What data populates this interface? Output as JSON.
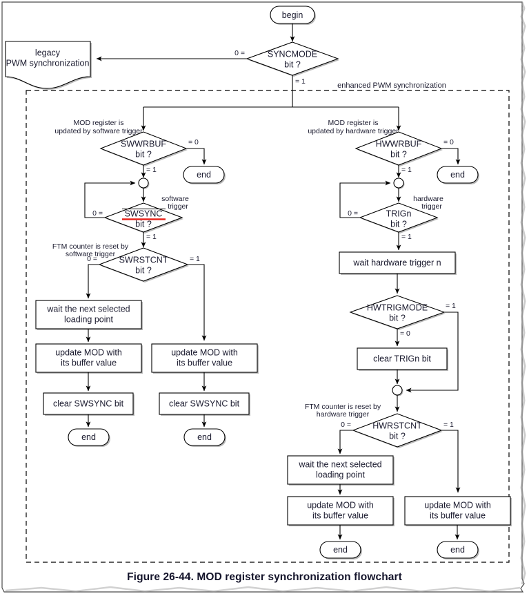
{
  "figure": {
    "caption": "Figure 26-44. MOD register synchronization flowchart",
    "region_label": "enhanced PWM synchronization"
  },
  "nodes": {
    "begin": "begin",
    "syncmode": {
      "line1": "SYNCMODE",
      "line2": "bit ?"
    },
    "legacy": {
      "line1": "legacy",
      "line2": "PWM synchronization"
    },
    "sw_annot": {
      "line1": "MOD register is",
      "line2": "updated by software trigger"
    },
    "swwrbuf": {
      "line1": "SWWRBUF",
      "line2": "bit ?"
    },
    "sw_end_top": "end",
    "sw_trigger_annot": {
      "line1": "software",
      "line2": "trigger"
    },
    "swsync": {
      "line1": "SWSYNC",
      "line2": "bit ?"
    },
    "sw_reset_annot": {
      "line1": "FTM counter is reset by",
      "line2": "software trigger"
    },
    "swrstcnt": {
      "line1": "SWRSTCNT",
      "line2": "bit ?"
    },
    "sw_wait": {
      "line1": "wait the next selected",
      "line2": "loading point"
    },
    "sw_update_left": {
      "line1": "update MOD with",
      "line2": "its buffer value"
    },
    "sw_update_right": {
      "line1": "update MOD with",
      "line2": "its buffer value"
    },
    "sw_clear_left": "clear SWSYNC bit",
    "sw_clear_right": "clear SWSYNC bit",
    "sw_end_left": "end",
    "sw_end_right": "end",
    "hw_annot": {
      "line1": "MOD register is",
      "line2": "updated by hardware trigger"
    },
    "hwwrbuf": {
      "line1": "HWWRBUF",
      "line2": "bit ?"
    },
    "hw_end_top": "end",
    "hw_trigger_annot": {
      "line1": "hardware",
      "line2": "trigger"
    },
    "trign": {
      "line1": "TRIGn",
      "line2": "bit ?"
    },
    "hw_wait_trigger": "wait hardware trigger n",
    "hwtrigmode": {
      "line1": "HWTRIGMODE",
      "line2": "bit ?"
    },
    "hw_clear_trign": "clear TRIGn bit",
    "hw_reset_annot": {
      "line1": "FTM counter is reset by",
      "line2": "hardware trigger"
    },
    "hwrstcnt": {
      "line1": "HWRSTCNT",
      "line2": "bit ?"
    },
    "hw_wait": {
      "line1": "wait the next selected",
      "line2": "loading point"
    },
    "hw_update_left": {
      "line1": "update MOD with",
      "line2": "its buffer value"
    },
    "hw_update_right": {
      "line1": "update MOD with",
      "line2": "its buffer value"
    },
    "hw_end_left": "end",
    "hw_end_right": "end"
  },
  "edge_labels": {
    "syncmode_zero": "0 =",
    "syncmode_one": "= 1",
    "swwrbuf_zero": "= 0",
    "swwrbuf_one": "= 1",
    "swsync_zero": "0 =",
    "swsync_one": "= 1",
    "swrstcnt_zero": "0 =",
    "swrstcnt_one": "= 1",
    "hwwrbuf_zero": "= 0",
    "hwwrbuf_one": "= 1",
    "trign_zero": "0 =",
    "trign_one": "= 1",
    "hwtrigmode_one": "= 1",
    "hwtrigmode_zero": "= 0",
    "hwrstcnt_zero": "0 =",
    "hwrstcnt_one": "= 1"
  },
  "colors": {
    "highlight": "#e8241c",
    "ink": "#1a1a2e",
    "line": "#000000",
    "shadow": "#b9b9b9",
    "page_border": "#4a4a4a"
  }
}
